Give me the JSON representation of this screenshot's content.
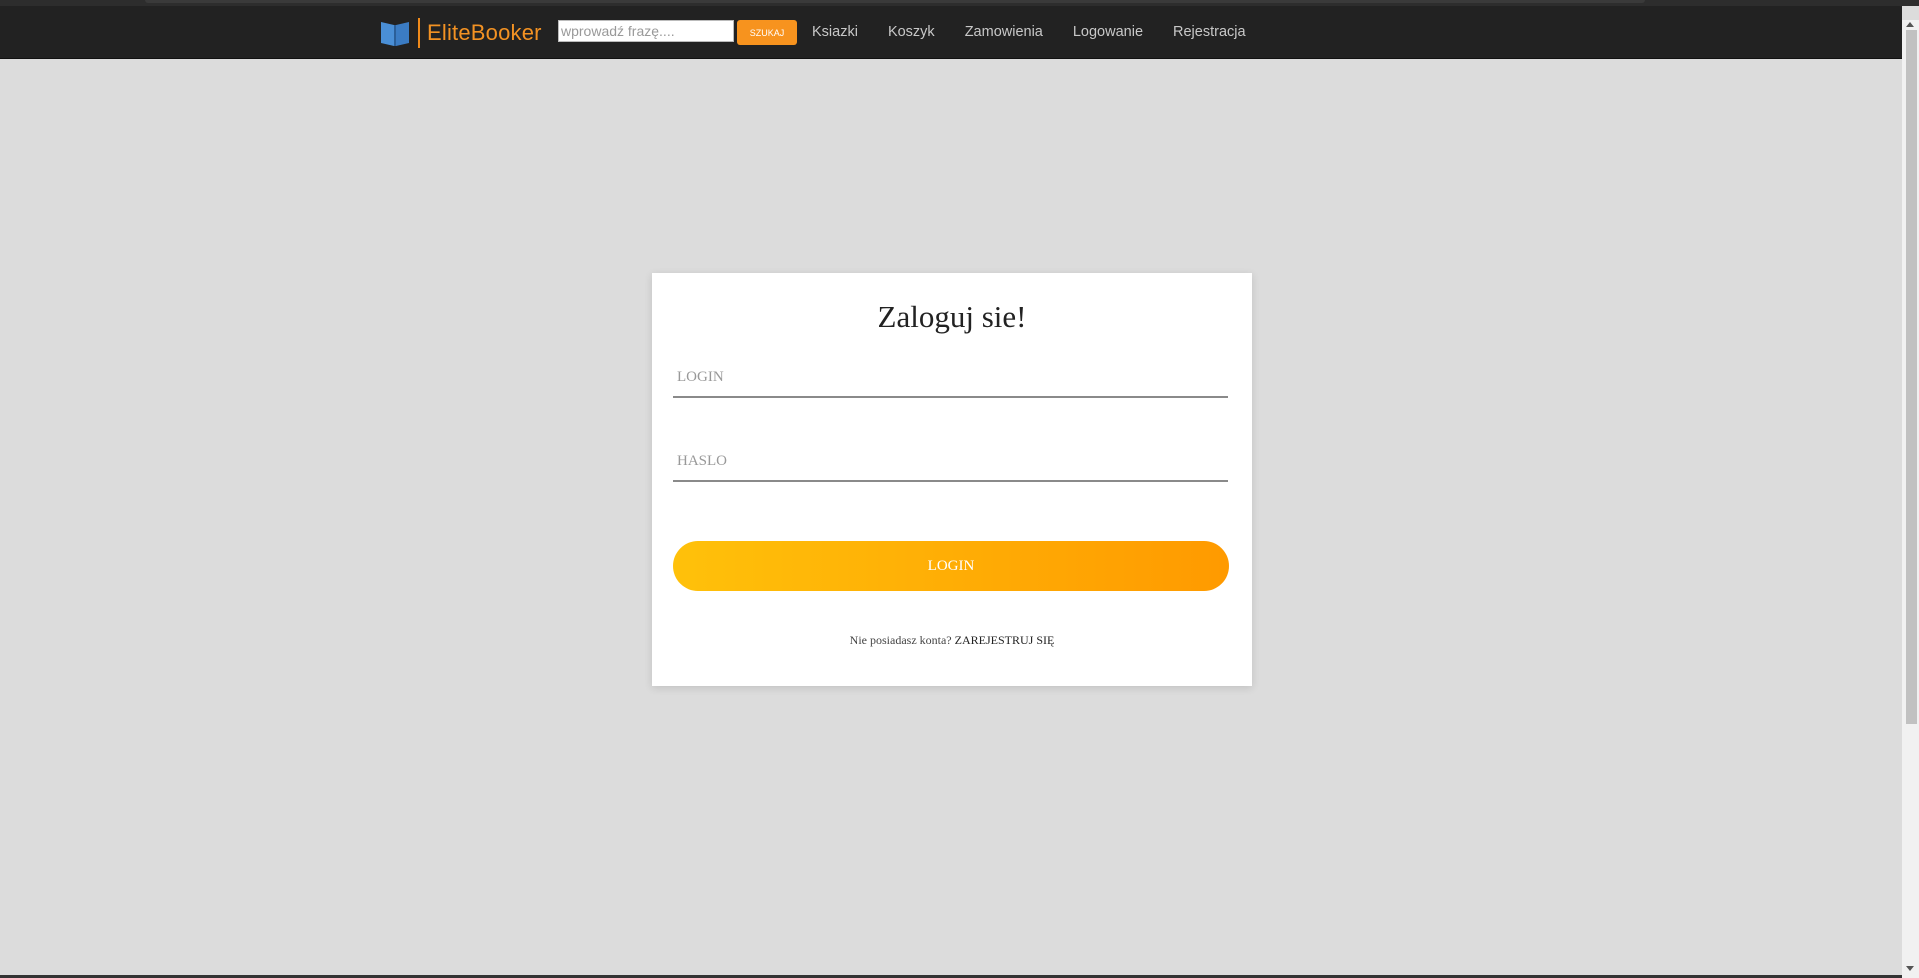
{
  "brand": {
    "name": "EliteBooker",
    "accent": "#f39223",
    "book_icon": "open-book-icon"
  },
  "search": {
    "placeholder": "wprowadź frazę....",
    "value": "",
    "button_label": "SZUKAJ"
  },
  "nav": {
    "items": [
      {
        "label": "Ksiazki"
      },
      {
        "label": "Koszyk"
      },
      {
        "label": "Zamowienia"
      },
      {
        "label": "Logowanie"
      },
      {
        "label": "Rejestracja"
      }
    ]
  },
  "login_form": {
    "title": "Zaloguj sie!",
    "login_placeholder": "LOGIN",
    "login_value": "",
    "password_placeholder": "HASLO",
    "password_value": "",
    "submit_label": "LOGIN",
    "no_account_text": "Nie posiadasz konta?",
    "register_link": "ZAREJESTRUJ SIĘ",
    "button_gradient": [
      "#ffc10a",
      "#ff9a00"
    ]
  },
  "colors": {
    "navbar_bg": "#222222",
    "page_bg": "#dcdcdc",
    "search_button": "#f7931e"
  }
}
